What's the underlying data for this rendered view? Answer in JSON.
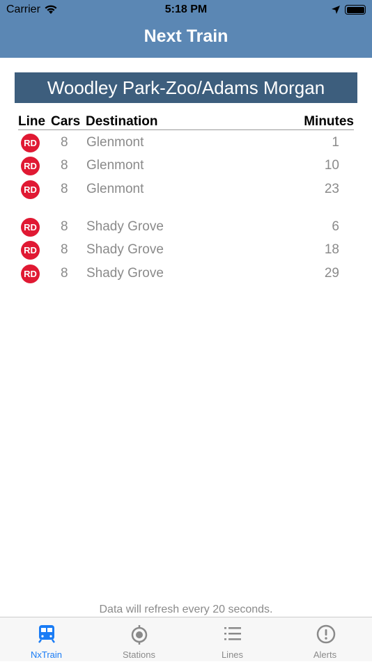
{
  "status_bar": {
    "carrier": "Carrier",
    "time": "5:18 PM"
  },
  "nav": {
    "title": "Next Train"
  },
  "station": "Woodley Park-Zoo/Adams Morgan",
  "table": {
    "headers": {
      "line": "Line",
      "cars": "Cars",
      "destination": "Destination",
      "minutes": "Minutes"
    },
    "rows": [
      {
        "line": "RD",
        "cars": "8",
        "destination": "Glenmont",
        "minutes": "1"
      },
      {
        "line": "RD",
        "cars": "8",
        "destination": "Glenmont",
        "minutes": "10"
      },
      {
        "line": "RD",
        "cars": "8",
        "destination": "Glenmont",
        "minutes": "23"
      },
      {
        "line": "RD",
        "cars": "8",
        "destination": "Shady Grove",
        "minutes": "6"
      },
      {
        "line": "RD",
        "cars": "8",
        "destination": "Shady Grove",
        "minutes": "18"
      },
      {
        "line": "RD",
        "cars": "8",
        "destination": "Shady Grove",
        "minutes": "29"
      }
    ]
  },
  "refresh_note": "Data will refresh every 20 seconds.",
  "tabs": [
    {
      "label": "NxTrain",
      "icon": "train-icon",
      "active": true
    },
    {
      "label": "Stations",
      "icon": "location-target-icon"
    },
    {
      "label": "Lines",
      "icon": "list-icon"
    },
    {
      "label": "Alerts",
      "icon": "alert-icon"
    }
  ],
  "colors": {
    "nav": "#5b87b4",
    "station_bar": "#3d5e7d",
    "red_line": "#e01933",
    "active_tab": "#1a7cf5"
  }
}
